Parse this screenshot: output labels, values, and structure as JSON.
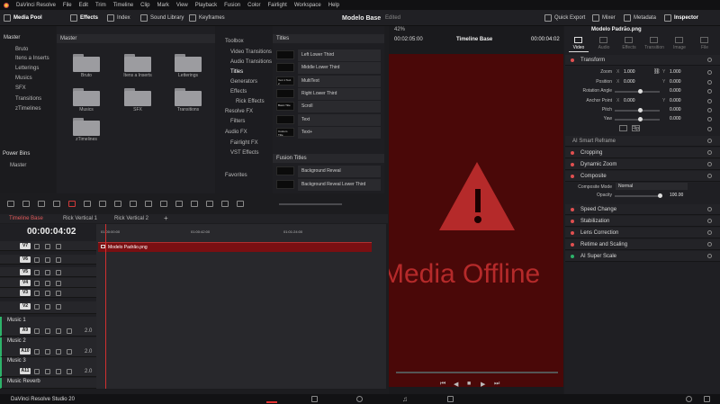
{
  "menu": {
    "app": "DaVinci Resolve",
    "items": [
      "File",
      "Edit",
      "Trim",
      "Timeline",
      "Clip",
      "Mark",
      "View",
      "Playback",
      "Fusion",
      "Color",
      "Fairlight",
      "Workspace",
      "Help"
    ]
  },
  "toolbar": {
    "media_pool": "Media Pool",
    "effects": "Effects",
    "index": "Index",
    "sound_library": "Sound Library",
    "keyframes": "Keyframes",
    "project": "Modelo Base",
    "status": "Edited",
    "quick_export": "Quick Export",
    "mixer": "Mixer",
    "metadata": "Metadata",
    "inspector": "Inspector"
  },
  "bins": {
    "root": "Master",
    "items": [
      "Bruto",
      "Itens a Inserts",
      "Letterings",
      "Musics",
      "SFX",
      "Transitions",
      "zTimelines"
    ],
    "power_bins": "Power Bins",
    "power_master": "Master"
  },
  "media": {
    "header": "Master",
    "folders": [
      "Bruto",
      "Itens a Inserts",
      "Letterings",
      "Musics",
      "SFX",
      "Transitions",
      "zTimelines"
    ]
  },
  "effects_tree": {
    "items": [
      "Toolbox",
      "Video Transitions",
      "Audio Transitions",
      "Titles",
      "Generators",
      "Effects",
      "Rick Effects",
      "Resolve FX",
      "Filters",
      "Audio FX",
      "Fairlight FX",
      "VST Effects",
      "Favorites"
    ]
  },
  "titles": {
    "header": "Titles",
    "items": [
      "Left Lower Third",
      "Middle Lower Third",
      "MultiText",
      "Right Lower Third",
      "Scroll",
      "Text",
      "Text+"
    ],
    "thumbs": [
      "",
      "",
      "Text 1\nText 2",
      "",
      "Basic Title",
      "",
      "Custom Title"
    ],
    "fusion_header": "Fusion Titles",
    "fusion_items": [
      "Background Reveal",
      "Background Reveal Lower Third"
    ]
  },
  "viewer": {
    "zoom": "42%",
    "timecode_left": "00:02:05:00",
    "timeline_name": "Timeline Base",
    "timecode_right": "00:00:04:02",
    "offline_text": "Media Offline",
    "offline_bg": "#4a0808",
    "warning_color": "#b52a2a"
  },
  "timeline": {
    "tabs": [
      "Timeline Base",
      "Rick Vertical 1",
      "Rick Vertical 2"
    ],
    "timecode": "00:00:04:02",
    "ruler": [
      "01:00:00:00",
      "01:00:42:00",
      "01:01:24:00"
    ],
    "clip_name": "Modelo Padrão.png",
    "clip_color": "#7a0f12",
    "video_tracks": [
      "V7",
      "V6",
      "V5",
      "V4",
      "V3",
      "V2"
    ],
    "audio_tracks": [
      {
        "name": "Music 1",
        "id": "A9",
        "level": "2.0"
      },
      {
        "name": "Music 2",
        "id": "A10",
        "level": "2.0"
      },
      {
        "name": "Music 3",
        "id": "A11",
        "level": "2.0"
      },
      {
        "name": "Music Reverb",
        "id": "",
        "level": ""
      }
    ]
  },
  "inspector": {
    "file": "Modelo Padrão.png",
    "tabs": [
      "Video",
      "Audio",
      "Effects",
      "Transition",
      "Image",
      "File"
    ],
    "transform": "Transform",
    "zoom_label": "Zoom",
    "zoom_x": "1.000",
    "zoom_y": "1.000",
    "position_label": "Position",
    "pos_x": "0.000",
    "pos_y": "0.000",
    "rotation_label": "Rotation Angle",
    "rotation": "0.000",
    "anchor_label": "Anchor Point",
    "anchor_x": "0.000",
    "anchor_y": "0.000",
    "pitch_label": "Pitch",
    "pitch": "0.000",
    "yaw_label": "Yaw",
    "yaw": "0.000",
    "flip_label": "Flip",
    "smart_reframe": "AI Smart Reframe",
    "cropping": "Cropping",
    "dynamic_zoom": "Dynamic Zoom",
    "composite": "Composite",
    "composite_mode_label": "Composite Mode",
    "composite_mode": "Normal",
    "opacity_label": "Opacity",
    "opacity": "100.00",
    "speed_change": "Speed Change",
    "stabilization": "Stabilization",
    "lens_correction": "Lens Correction",
    "retime": "Retime and Scaling",
    "super_scale": "AI Super Scale"
  },
  "bottom": {
    "brand": "DaVinci Resolve Studio 20"
  }
}
